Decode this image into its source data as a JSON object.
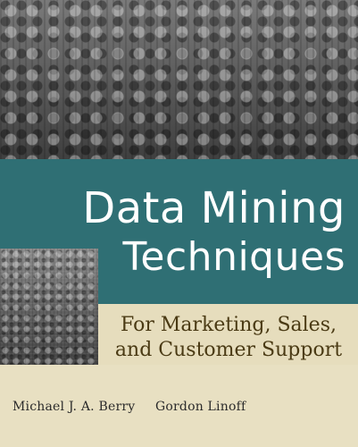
{
  "cover": {
    "title_line_1": "Data Mining",
    "title_line_2": "Techniques",
    "subtitle_line_1": "For Marketing, Sales,",
    "subtitle_line_2": "and Customer Support",
    "author_1": "Michael J. A. Berry",
    "author_2": "Gordon Linoff"
  },
  "colors": {
    "teal_band": "#2f6f74",
    "cream": "#e6ddbd",
    "subtitle": "#4a3a14",
    "title": "#ffffff"
  }
}
